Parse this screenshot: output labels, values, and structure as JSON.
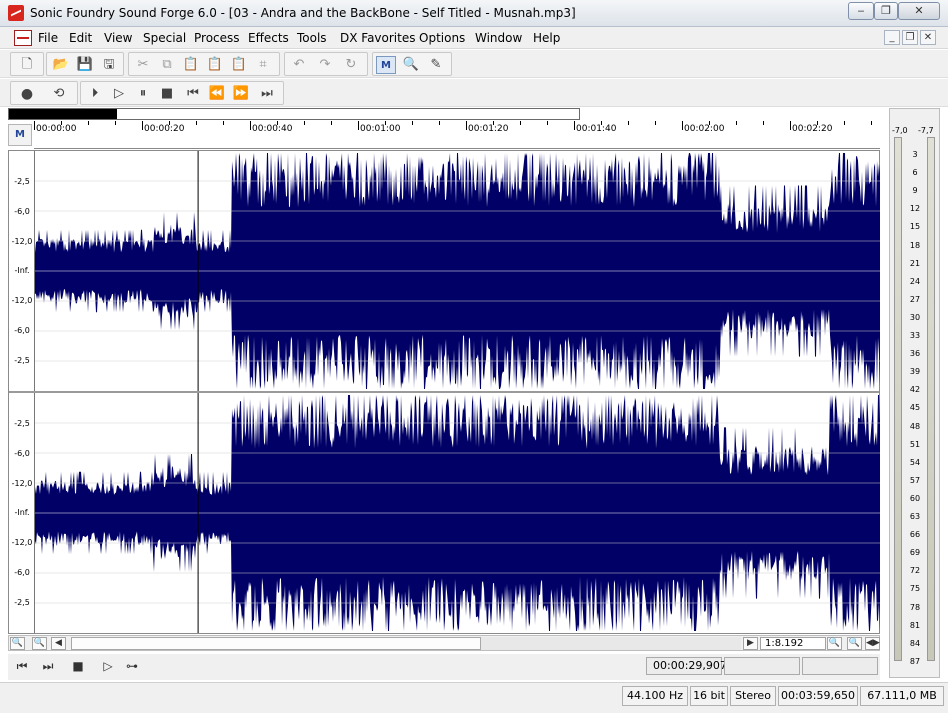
{
  "window": {
    "title": "Sonic Foundry Sound Forge 6.0 - [03 - Andra and the BackBone - Self Titled - Musnah.mp3]",
    "controls": {
      "minimize": "‒",
      "restore": "❐",
      "close": "✕"
    }
  },
  "menu": {
    "items": [
      "File",
      "Edit",
      "View",
      "Special",
      "Process",
      "Effects",
      "Tools",
      "DX Favorites",
      "Options",
      "Window",
      "Help"
    ],
    "mdi_controls": {
      "minimize": "_",
      "restore": "❐",
      "close": "✕"
    }
  },
  "toolbar": {
    "icons": [
      "new-file-icon",
      "open-folder-icon",
      "save-icon",
      "save-all-icon",
      "cut-icon",
      "copy-icon",
      "paste-icon",
      "paste-mix-icon",
      "paste-crossfade-icon",
      "trim-crop-icon",
      "undo-icon",
      "redo-icon",
      "repeat-icon",
      "edit-tool-icon",
      "magnify-tool-icon",
      "pencil-tool-icon"
    ]
  },
  "transport": {
    "icons": [
      "record-icon",
      "loop-playback-icon",
      "play-all-icon",
      "play-icon",
      "pause-icon",
      "stop-icon",
      "go-to-start-icon",
      "rewind-icon",
      "fast-forward-icon",
      "go-to-end-icon"
    ]
  },
  "ruler": {
    "labels": [
      "00:00:00",
      "00:00:20",
      "00:00:40",
      "00:01:00",
      "00:01:20",
      "00:01:40",
      "00:02:00",
      "00:02:20"
    ]
  },
  "scale": {
    "labels": [
      "-2,5",
      "-6,0",
      "-12,0",
      "-Inf.",
      "-12,0",
      "-6,0",
      "-2,5"
    ]
  },
  "meters": {
    "peak_left": "-7,0",
    "peak_right": "-7,7",
    "scale": [
      "3",
      "6",
      "9",
      "12",
      "15",
      "18",
      "21",
      "24",
      "27",
      "30",
      "33",
      "36",
      "39",
      "42",
      "45",
      "48",
      "51",
      "54",
      "57",
      "60",
      "63",
      "66",
      "69",
      "72",
      "75",
      "78",
      "81",
      "84",
      "87"
    ]
  },
  "zoom": {
    "ratio": "1:8.192"
  },
  "position": {
    "cursor_time": "00:00:29,907",
    "selection_length": ""
  },
  "status": {
    "sample_rate": "44.100 Hz",
    "bit_depth": "16 bit",
    "channels": "Stereo",
    "length": "00:03:59,650",
    "free_space": "67.111,0 MB"
  },
  "waveform": {
    "color": "#000066",
    "cursor_fraction": 0.193,
    "quiet_intro_end_fraction": 0.232,
    "loud_section_end_fraction": 0.81,
    "second_loud_start_fraction": 0.94,
    "intro_level": 0.28,
    "loud_level": 0.98,
    "break_level": 0.58
  }
}
